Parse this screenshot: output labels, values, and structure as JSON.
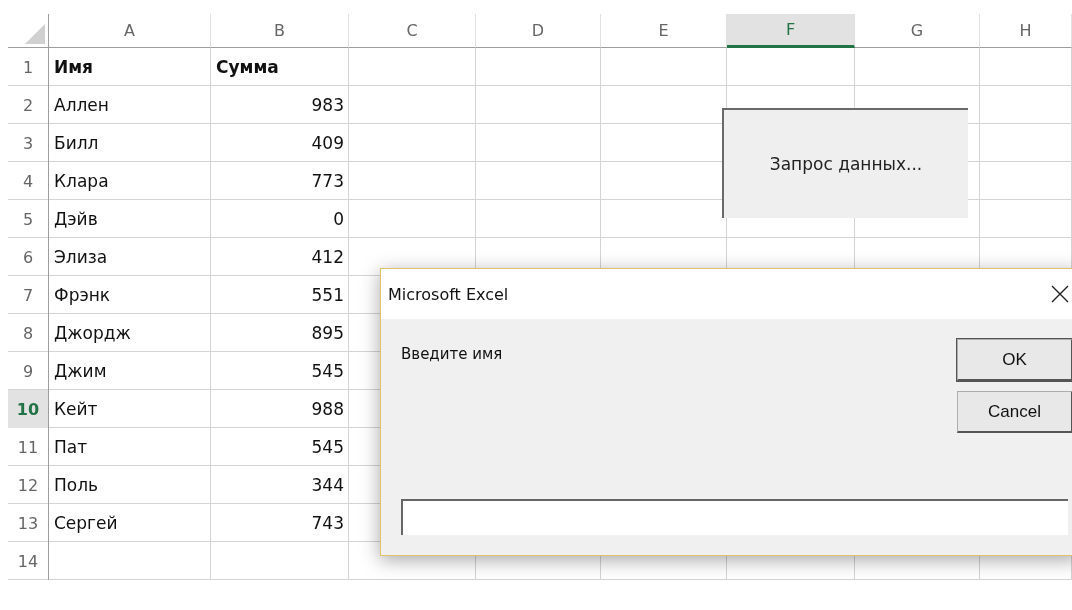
{
  "sheet": {
    "columns": [
      {
        "label": "A",
        "selected": false
      },
      {
        "label": "B",
        "selected": false
      },
      {
        "label": "C",
        "selected": false
      },
      {
        "label": "D",
        "selected": false
      },
      {
        "label": "E",
        "selected": false
      },
      {
        "label": "F",
        "selected": true
      },
      {
        "label": "G",
        "selected": false
      },
      {
        "label": "H",
        "selected": false
      }
    ],
    "rows": [
      {
        "number": "1",
        "selected": false,
        "kind": "header",
        "cells": [
          "Имя",
          "Сумма"
        ]
      },
      {
        "number": "2",
        "selected": false,
        "kind": "data",
        "cells": [
          "Аллен",
          "983"
        ]
      },
      {
        "number": "3",
        "selected": false,
        "kind": "data",
        "cells": [
          "Билл",
          "409"
        ]
      },
      {
        "number": "4",
        "selected": false,
        "kind": "data",
        "cells": [
          "Клара",
          "773"
        ]
      },
      {
        "number": "5",
        "selected": false,
        "kind": "data",
        "cells": [
          "Дэйв",
          "0"
        ]
      },
      {
        "number": "6",
        "selected": false,
        "kind": "data",
        "cells": [
          "Элиза",
          "412"
        ]
      },
      {
        "number": "7",
        "selected": false,
        "kind": "data",
        "cells": [
          "Фрэнк",
          "551"
        ]
      },
      {
        "number": "8",
        "selected": false,
        "kind": "data",
        "cells": [
          "Джордж",
          "895"
        ]
      },
      {
        "number": "9",
        "selected": false,
        "kind": "data",
        "cells": [
          "Джим",
          "545"
        ]
      },
      {
        "number": "10",
        "selected": true,
        "kind": "data",
        "cells": [
          "Кейт",
          "988"
        ]
      },
      {
        "number": "11",
        "selected": false,
        "kind": "data",
        "cells": [
          "Пат",
          "545"
        ]
      },
      {
        "number": "12",
        "selected": false,
        "kind": "data",
        "cells": [
          "Поль",
          "344"
        ]
      },
      {
        "number": "13",
        "selected": false,
        "kind": "data",
        "cells": [
          "Сергей",
          "743"
        ]
      },
      {
        "number": "14",
        "selected": false
      }
    ]
  },
  "form_button": {
    "label": "Запрос данных..."
  },
  "dialog": {
    "title": "Microsoft Excel",
    "message": "Введите имя",
    "buttons": [
      "OK",
      "Cancel"
    ]
  }
}
